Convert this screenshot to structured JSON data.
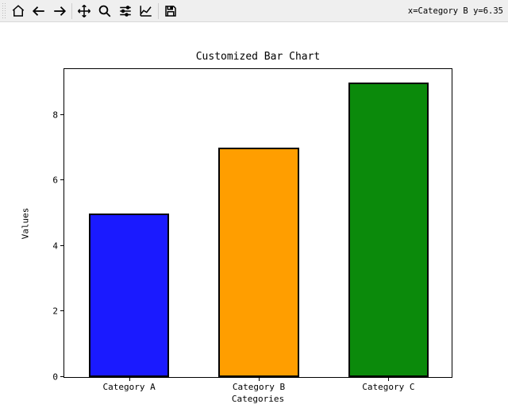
{
  "toolbar": {
    "icons": [
      {
        "name": "home-icon"
      },
      {
        "name": "back-icon"
      },
      {
        "name": "forward-icon"
      },
      {
        "sep": true
      },
      {
        "name": "pan-icon"
      },
      {
        "name": "zoom-icon"
      },
      {
        "name": "subplots-icon"
      },
      {
        "name": "axis-edit-icon"
      },
      {
        "sep": true
      },
      {
        "name": "save-icon"
      }
    ],
    "coord_readout": "x=Category B y=6.35"
  },
  "chart_data": {
    "type": "bar",
    "title": "Customized Bar Chart",
    "xlabel": "Categories",
    "ylabel": "Values",
    "categories": [
      "Category A",
      "Category B",
      "Category C"
    ],
    "values": [
      5,
      7,
      9
    ],
    "colors": [
      "#1a1aff",
      "#ff9e00",
      "#0b8a0b"
    ],
    "yticks": [
      0,
      2,
      4,
      6,
      8
    ],
    "ylim": [
      0,
      9.45
    ]
  }
}
